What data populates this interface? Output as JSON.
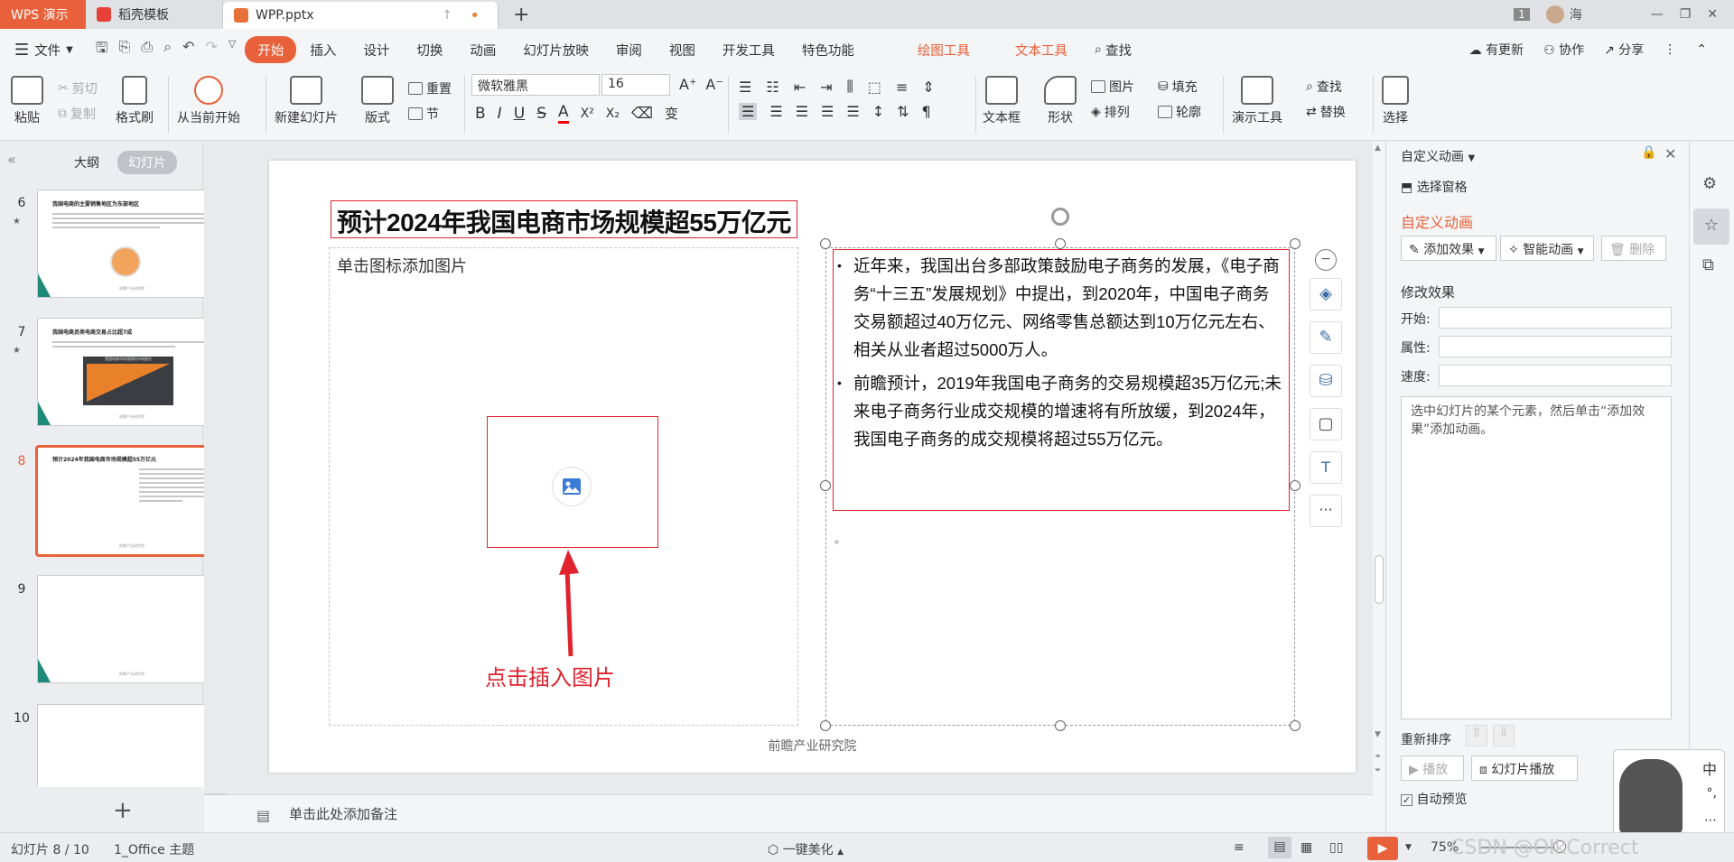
{
  "titlebar": {
    "app_tab": "WPS 演示",
    "tab_template": "稻壳模板",
    "tab_file": "WPP.pptx",
    "new_tab": "+",
    "badge": "1",
    "user": "海"
  },
  "menubar": {
    "file": "文件",
    "items": [
      "开始",
      "插入",
      "设计",
      "切换",
      "动画",
      "幻灯片放映",
      "审阅",
      "视图",
      "开发工具",
      "特色功能"
    ],
    "tool_tabs": [
      "绘图工具",
      "文本工具"
    ],
    "search": "查找",
    "update": "有更新",
    "collab": "协作",
    "share": "分享"
  },
  "ribbon": {
    "paste": "粘贴",
    "cut": "剪切",
    "copy": "复制",
    "format_painter": "格式刷",
    "from_current": "从当前开始",
    "new_slide": "新建幻灯片",
    "layout": "版式",
    "reset": "重置",
    "section": "节",
    "font_name": "微软雅黑",
    "font_size": "16",
    "bold": "B",
    "italic": "I",
    "underline": "U",
    "strike": "S",
    "font_color": "A",
    "superscript": "X²",
    "subscript": "X₂",
    "transform": "变",
    "textbox": "文本框",
    "shape": "形状",
    "picture": "图片",
    "fill": "填充",
    "arrange": "排列",
    "outline": "轮廓",
    "presenter_tools": "演示工具",
    "find": "查找",
    "replace": "替换",
    "select": "选择"
  },
  "left_panel": {
    "tab_outline": "大纲",
    "tab_slides": "幻灯片",
    "thumbnails": [
      {
        "num": "6",
        "title": "我国电商的主要销售地区为东部地区"
      },
      {
        "num": "7",
        "title": "我国电商员类电商交易占比超7成",
        "chart_title": "我国电商市场规模的市场细分"
      },
      {
        "num": "8",
        "title": "预计2024年我国电商市场规模超55万亿元"
      },
      {
        "num": "9",
        "title": ""
      },
      {
        "num": "10",
        "title": ""
      }
    ],
    "thumb_footer": "前瞻产业研究院",
    "add_slide": "+"
  },
  "slide": {
    "title": "预计2024年我国电商市场规模超55万亿元",
    "placeholder_text": "单击图标添加图片",
    "annotation": "点击插入图片",
    "bullets": [
      "近年来，我国出台多部政策鼓励电子商务的发展，《电子商务“十三五”发展规划》中提出，到2020年，中国电子商务交易额超过40万亿元、网络零售总额达到10万亿元左右、相关从业者超过5000万人。",
      "前瞻预计，2019年我国电子商务的交易规模超35万亿元;未来电子商务行业成交规模的增速将有所放缓，到2024年，我国电子商务的成交规模将超过55万亿元。"
    ],
    "footer": "前瞻产业研究院",
    "side_more": "···"
  },
  "notes": {
    "placeholder": "单击此处添加备注"
  },
  "right_panel": {
    "header": "自定义动画",
    "select_pane": "选择窗格",
    "section_title": "自定义动画",
    "add_effect": "添加效果",
    "smart_anim": "智能动画",
    "delete": "删除",
    "modify_effect": "修改效果",
    "start": "开始:",
    "property": "属性:",
    "speed": "速度:",
    "hint": "选中幻灯片的某个元素，然后单击“添加效果”添加动画。",
    "reorder": "重新排序",
    "play": "播放",
    "slideshow": "幻灯片播放",
    "auto_preview": "自动预览"
  },
  "ime": {
    "zh": "中",
    "punct": "°,",
    "more": "⋯"
  },
  "statusbar": {
    "slide_pos": "幻灯片 8 / 10",
    "theme": "1_Office 主题",
    "beautify": "一键美化",
    "zoom": "75%",
    "watermark": "CSDN @OIkCorrect"
  },
  "colors": {
    "accent": "#e8613a",
    "red": "#e0232e"
  }
}
